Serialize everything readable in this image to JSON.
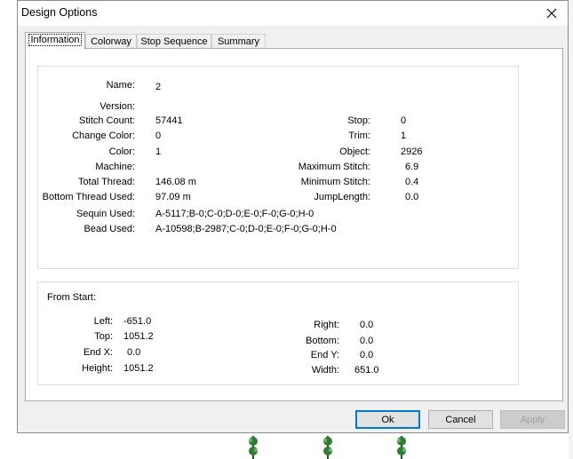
{
  "dialog": {
    "title": "Design Options"
  },
  "tabs": [
    {
      "label": "Information"
    },
    {
      "label": "Colorway"
    },
    {
      "label": "Stop Sequence"
    },
    {
      "label": "Summary"
    }
  ],
  "info": {
    "name_label": "Name:",
    "name_value": "2",
    "version_label": "Version:",
    "version_value": "",
    "stitch_count_label": "Stitch Count:",
    "stitch_count_value": "57441",
    "change_color_label": "Change Color:",
    "change_color_value": "0",
    "color_label": "Color:",
    "color_value": "1",
    "machine_label": "Machine:",
    "machine_value": "",
    "total_thread_label": "Total Thread:",
    "total_thread_value": "146.08 m",
    "bottom_thread_label": "Bottom Thread Used:",
    "bottom_thread_value": "97.09 m",
    "sequin_label": "Sequin Used:",
    "sequin_value": "A-5117;B-0;C-0;D-0;E-0;F-0;G-0;H-0",
    "bead_label": "Bead Used:",
    "bead_value": "A-10598;B-2987;C-0;D-0;E-0;F-0;G-0;H-0",
    "stop_label": "Stop:",
    "stop_value": "0",
    "trim_label": "Trim:",
    "trim_value": "1",
    "object_label": "Object:",
    "object_value": "2926",
    "max_stitch_label": "Maximum Stitch:",
    "max_stitch_value": "6.9",
    "min_stitch_label": "Minimum Stitch:",
    "min_stitch_value": "0.4",
    "jump_length_label": "JumpLength:",
    "jump_length_value": "0.0"
  },
  "from_start": {
    "heading": "From Start:",
    "left_label": "Left:",
    "left_value": "-651.0",
    "top_label": "Top:",
    "top_value": "1051.2",
    "end_x_label": "End X:",
    "end_x_value": "0.0",
    "height_label": "Height:",
    "height_value": "1051.2",
    "right_label": "Right:",
    "right_value": "0.0",
    "bottom_label": "Bottom:",
    "bottom_value": "0.0",
    "end_y_label": "End Y:",
    "end_y_value": "0.0",
    "width_label": "Width:",
    "width_value": "651.0"
  },
  "buttons": {
    "ok": "Ok",
    "cancel": "Cancel",
    "apply": "Apply"
  },
  "colors": {
    "accent": "#0078d7",
    "plant": "#2e7d32"
  }
}
